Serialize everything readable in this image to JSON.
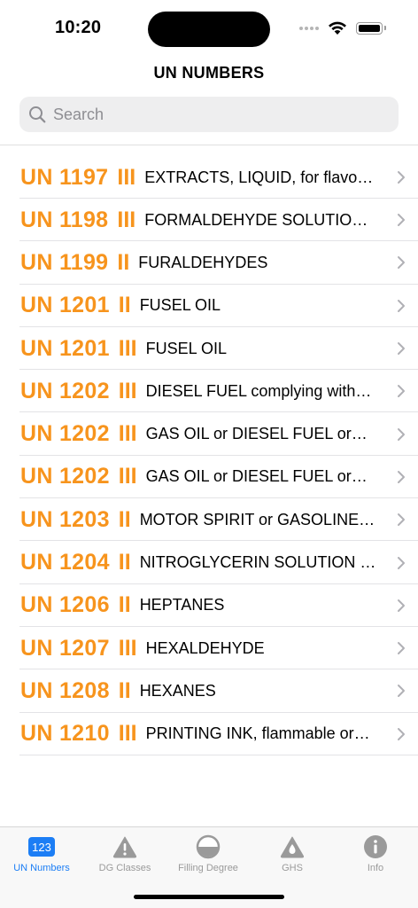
{
  "status": {
    "time": "10:20"
  },
  "nav": {
    "title": "UN NUMBERS"
  },
  "search": {
    "placeholder": "Search",
    "value": ""
  },
  "rows": [
    {
      "un": "UN 1197",
      "pg": "III",
      "name": "EXTRACTS, LIQUID, for flavour or aroma"
    },
    {
      "un": "UN 1198",
      "pg": "III",
      "name": "FORMALDEHYDE SOLUTION…"
    },
    {
      "un": "UN 1199",
      "pg": "II",
      "name": "FURALDEHYDES"
    },
    {
      "un": "UN 1201",
      "pg": "II",
      "name": "FUSEL OIL"
    },
    {
      "un": "UN 1201",
      "pg": "III",
      "name": "FUSEL OIL"
    },
    {
      "un": "UN 1202",
      "pg": "III",
      "name": "DIESEL FUEL complying with…"
    },
    {
      "un": "UN 1202",
      "pg": "III",
      "name": "GAS OIL or DIESEL FUEL or…"
    },
    {
      "un": "UN 1202",
      "pg": "III",
      "name": "GAS OIL or DIESEL FUEL or…"
    },
    {
      "un": "UN 1203",
      "pg": "II",
      "name": "MOTOR SPIRIT or GASOLINE…"
    },
    {
      "un": "UN 1204",
      "pg": "II",
      "name": "NITROGLYCERIN SOLUTION I…"
    },
    {
      "un": "UN 1206",
      "pg": "II",
      "name": "HEPTANES"
    },
    {
      "un": "UN 1207",
      "pg": "III",
      "name": "HEXALDEHYDE"
    },
    {
      "un": "UN 1208",
      "pg": "II",
      "name": "HEXANES"
    },
    {
      "un": "UN 1210",
      "pg": "III",
      "name": "PRINTING INK, flammable or…"
    }
  ],
  "tabs": [
    {
      "label": "UN Numbers",
      "icon": "123-icon",
      "badge": "123",
      "active": true
    },
    {
      "label": "DG Classes",
      "icon": "warning-triangle-icon",
      "active": false
    },
    {
      "label": "Filling Degree",
      "icon": "half-circle-icon",
      "active": false
    },
    {
      "label": "GHS",
      "icon": "drop-triangle-icon",
      "active": false
    },
    {
      "label": "Info",
      "icon": "info-icon",
      "active": false
    }
  ],
  "colors": {
    "accent": "#f7941d",
    "tab_active": "#1c7ef5",
    "tab_inactive": "#9a9a9a"
  }
}
